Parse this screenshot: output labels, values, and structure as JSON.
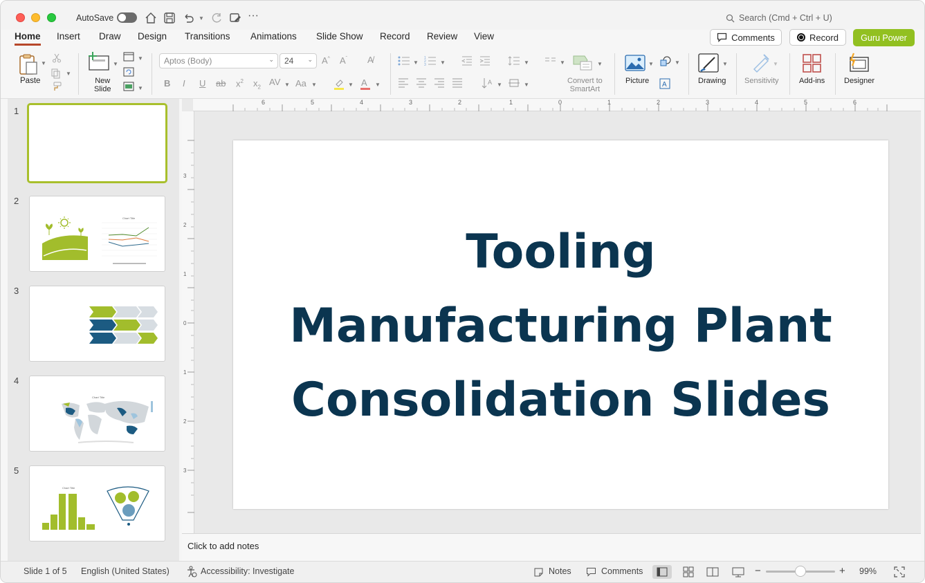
{
  "titlebar": {
    "autosave_label": "AutoSave",
    "search_placeholder": "Search (Cmd + Ctrl + U)"
  },
  "tabs": [
    {
      "label": "Home",
      "active": true
    },
    {
      "label": "Insert"
    },
    {
      "label": "Draw"
    },
    {
      "label": "Design"
    },
    {
      "label": "Transitions"
    },
    {
      "label": "Animations"
    },
    {
      "label": "Slide Show"
    },
    {
      "label": "Record"
    },
    {
      "label": "Review"
    },
    {
      "label": "View"
    }
  ],
  "header_buttons": {
    "comments": "Comments",
    "record": "Record",
    "guru": "Guru Power"
  },
  "ribbon": {
    "paste": "Paste",
    "new_slide_line1": "New",
    "new_slide_line2": "Slide",
    "font_name": "Aptos (Body)",
    "font_size": "24",
    "convert_line1": "Convert to",
    "convert_line2": "SmartArt",
    "picture": "Picture",
    "drawing": "Drawing",
    "sensitivity": "Sensitivity",
    "addins": "Add-ins",
    "designer": "Designer"
  },
  "thumbnails": [
    {
      "num": "1",
      "selected": true
    },
    {
      "num": "2"
    },
    {
      "num": "3"
    },
    {
      "num": "4"
    },
    {
      "num": "5"
    }
  ],
  "slide": {
    "title_lines": [
      "Tooling",
      "Manufacturing Plant",
      "Consolidation Slides"
    ],
    "title_color": "#0b3550"
  },
  "notes": {
    "placeholder": "Click to add notes"
  },
  "status": {
    "slide_count": "Slide 1 of 5",
    "language": "English (United States)",
    "accessibility": "Accessibility: Investigate",
    "notes": "Notes",
    "comments": "Comments",
    "zoom": "99%"
  },
  "colors": {
    "accent_tab": "#b7472a",
    "guru_green": "#92c021",
    "thumb_selected": "#a8bf2c"
  }
}
